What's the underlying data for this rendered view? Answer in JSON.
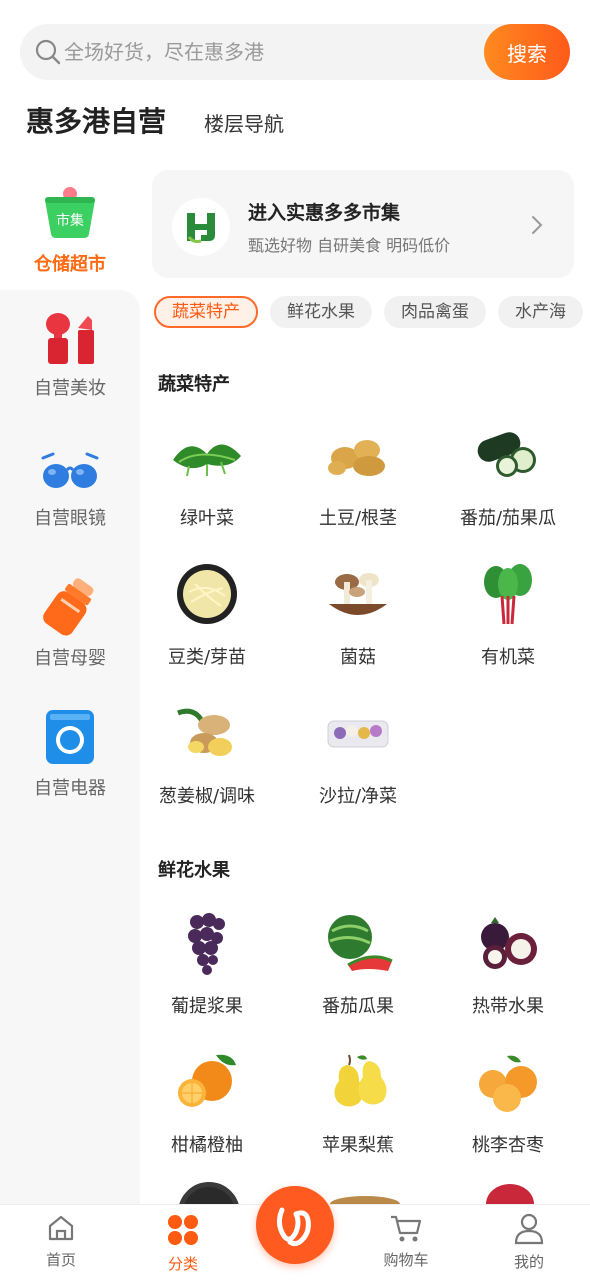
{
  "search": {
    "placeholder": "全场好货，尽在惠多港",
    "button_label": "搜索"
  },
  "header": {
    "title": "惠多港自营",
    "floor_nav": "楼层导航"
  },
  "sidebar": {
    "active": {
      "badge": "市集",
      "label": "仓储超市",
      "color": "#ff6a12"
    },
    "items": [
      {
        "label": "自营美妆",
        "icon": "lipstick-icon"
      },
      {
        "label": "自营眼镜",
        "icon": "sunglasses-icon"
      },
      {
        "label": "自营母婴",
        "icon": "baby-bottle-icon"
      },
      {
        "label": "自营电器",
        "icon": "camera-icon"
      }
    ]
  },
  "market": {
    "title": "进入实惠多多市集",
    "subtitle": "甄选好物 自研美食 明码低价"
  },
  "chips": [
    "蔬菜特产",
    "鲜花水果",
    "肉品禽蛋",
    "水产海"
  ],
  "sections": [
    {
      "title": "蔬菜特产",
      "items": [
        {
          "label": "绿叶菜",
          "icon": "leafy-greens-icon"
        },
        {
          "label": "土豆/根茎",
          "icon": "potato-icon"
        },
        {
          "label": "番茄/茄果瓜",
          "icon": "cucumber-icon"
        },
        {
          "label": "豆类/芽苗",
          "icon": "bean-sprouts-icon"
        },
        {
          "label": "菌菇",
          "icon": "mushroom-icon"
        },
        {
          "label": "有机菜",
          "icon": "organic-vegetable-icon"
        },
        {
          "label": "葱姜椒/调味",
          "icon": "ginger-icon"
        },
        {
          "label": "沙拉/净菜",
          "icon": "salad-box-icon"
        }
      ]
    },
    {
      "title": "鲜花水果",
      "items": [
        {
          "label": "葡提浆果",
          "icon": "grape-icon"
        },
        {
          "label": "番茄瓜果",
          "icon": "watermelon-icon"
        },
        {
          "label": "热带水果",
          "icon": "mangosteen-icon"
        },
        {
          "label": "柑橘橙柚",
          "icon": "orange-icon"
        },
        {
          "label": "苹果梨蕉",
          "icon": "pear-icon"
        },
        {
          "label": "桃李杏枣",
          "icon": "peach-icon"
        }
      ]
    }
  ],
  "bottom_nav": [
    {
      "label": "首页",
      "icon": "home-icon"
    },
    {
      "label": "分类",
      "icon": "category-icon"
    },
    {
      "label": "购物车",
      "icon": "cart-icon"
    },
    {
      "label": "我的",
      "icon": "user-icon"
    }
  ],
  "colors": {
    "accent": "#ff5a12",
    "accent_light": "#ff8a1f"
  }
}
